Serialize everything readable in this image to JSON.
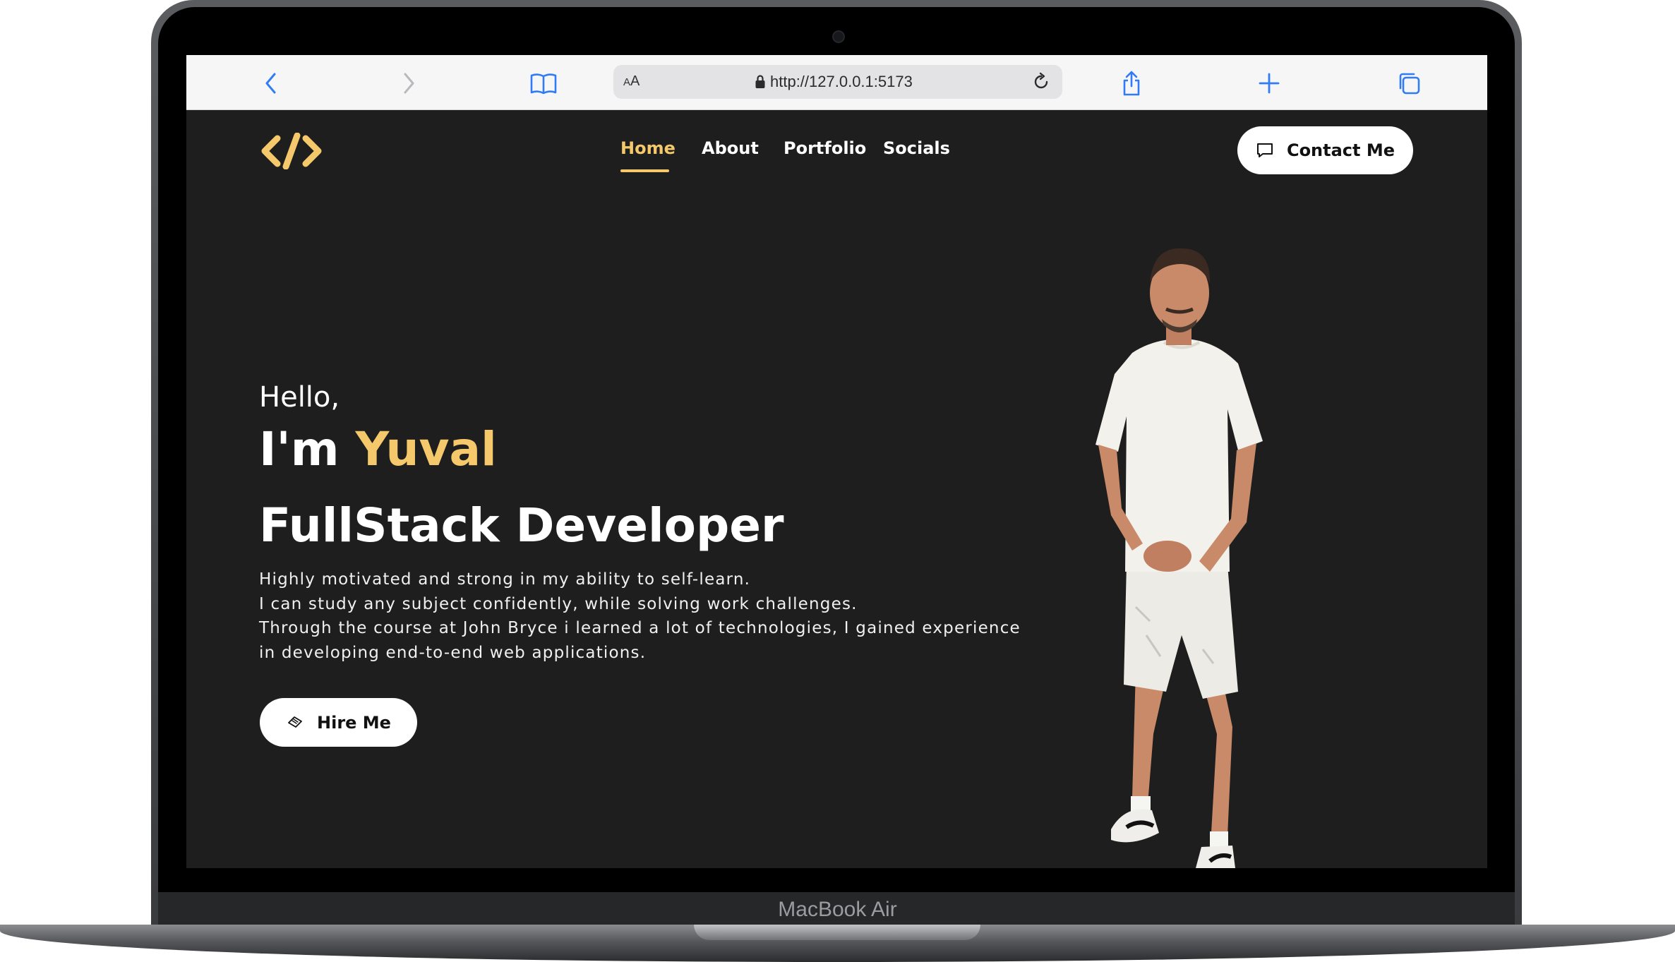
{
  "device": {
    "label": "MacBook Air"
  },
  "browser": {
    "url": "http://127.0.0.1:5173",
    "text_size_label_small": "A",
    "text_size_label_large": "A",
    "icons": {
      "back": "chevron-left-icon",
      "forward": "chevron-right-icon",
      "bookmarks": "book-icon",
      "lock": "lock-icon",
      "reload": "reload-icon",
      "share": "share-icon",
      "new_tab": "plus-icon",
      "tabs": "tabs-icon"
    },
    "colors": {
      "toolbar_icon": "#2f7cf6",
      "toolbar_icon_disabled": "#b9b9bd"
    }
  },
  "site": {
    "logo": "code-brackets-logo",
    "nav": [
      {
        "label": "Home",
        "active": true
      },
      {
        "label": "About",
        "active": false
      },
      {
        "label": "Portfolio",
        "active": false
      },
      {
        "label": "Socials",
        "active": false
      }
    ],
    "contact_button": {
      "label": "Contact Me",
      "icon": "chat-bubble-icon"
    },
    "hero": {
      "greeting": "Hello,",
      "intro": "I'm",
      "name": "Yuval",
      "role": "FullStack Developer",
      "bio_lines": [
        "Highly motivated and strong in my ability to self-learn.",
        "I can study any subject confidently, while solving work challenges.",
        "Through the course at John Bryce i learned a lot of technologies, I gained experience",
        "in developing end-to-end web applications."
      ],
      "hire_button": {
        "label": "Hire Me",
        "icon": "handshake-icon"
      }
    },
    "colors": {
      "background": "#1e1e1e",
      "accent": "#f5c96b",
      "text": "#ffffff"
    }
  }
}
